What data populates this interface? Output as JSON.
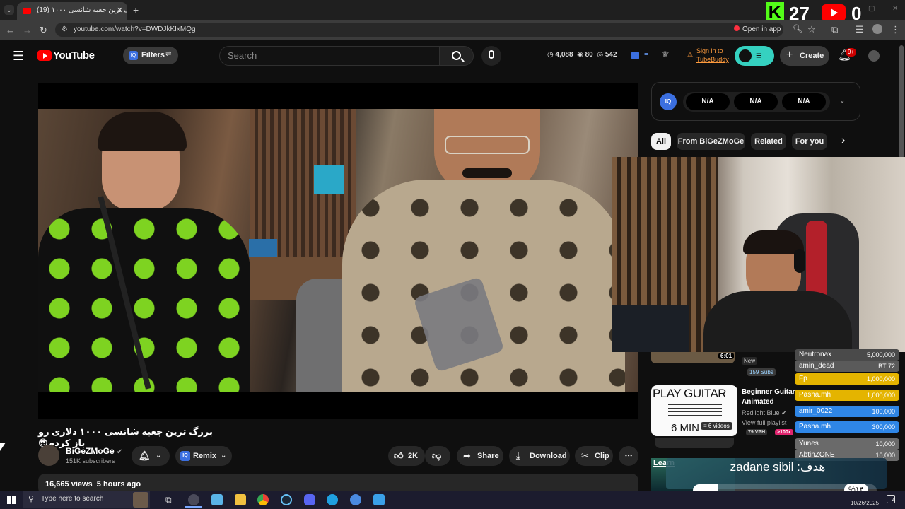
{
  "browser": {
    "tab_title": "(19) بزرگ ترین جعبه شانسی ۱۰۰۰",
    "url": "youtube.com/watch?v=DWDJkKIxMQg",
    "open_in_app": "Open in app"
  },
  "stream_overlay": {
    "counter_a": "27",
    "counter_b": "0"
  },
  "header": {
    "logo": "YouTube",
    "filters": "Filters",
    "search_placeholder": "Search",
    "stat_views": "4,088",
    "stat_eye": "80",
    "stat_hidden": "542",
    "signin_line1": "Sign in to",
    "signin_line2": "TubeBuddy",
    "create": "Create",
    "notifications": "9+"
  },
  "video": {
    "title": "بزرگ ترین جعبه شانسی ۱۰۰۰ دلاری رو باز کردم😎",
    "channel": "BiGeZMoGe",
    "subscribers": "151K subscribers",
    "remix": "Remix",
    "likes": "2K",
    "share": "Share",
    "download": "Download",
    "clip": "Clip",
    "views_time": "16,665 views  5 hours ago"
  },
  "sidebar": {
    "na_values": [
      "N/A",
      "N/A",
      "N/A"
    ],
    "chips": [
      "All",
      "From BiGeZMoGe",
      "Related",
      "For you"
    ],
    "item1": {
      "duration": "6:01",
      "badge": "New",
      "subs": "159 Subs"
    },
    "item2": {
      "thumb_title": "PLAY GUITAR",
      "thumb_sub": "6 MIN",
      "videos": "6 videos",
      "title": "Beginner Guitar Animated",
      "channel": "Redlight Blue",
      "full_playlist": "View full playlist",
      "vph": "79 VPH",
      "ratio": ">100x"
    },
    "learn": "Learn"
  },
  "donors": [
    {
      "name": "Neutronax",
      "amount": "5,000,000",
      "color": "#4a4a4a"
    },
    {
      "name": "amin_dead",
      "amount": "BT 72",
      "color": "#5a5a5a"
    },
    {
      "name": "Fp",
      "amount": "1,000,000",
      "color": "#e4b400"
    },
    {
      "name": "Pasha.mh",
      "amount": "1,000,000",
      "color": "#e4b400"
    },
    {
      "name": "amir_0022",
      "amount": "100,000",
      "color": "#2f86e6"
    },
    {
      "name": "Pasha.mh",
      "amount": "300,000",
      "color": "#2f86e6"
    },
    {
      "name": "Yunes",
      "amount": "10,000",
      "color": "#6a6a6a"
    },
    {
      "name": "AbtinZONE",
      "amount": "10,000",
      "color": "#6a6a6a"
    }
  ],
  "goal": {
    "label": "هدف: zadane sibil",
    "percent": "%۱۴",
    "progress": 0.14
  },
  "taskbar": {
    "search": "Type here to search",
    "date": "10/26/2025",
    "badge": "4"
  }
}
